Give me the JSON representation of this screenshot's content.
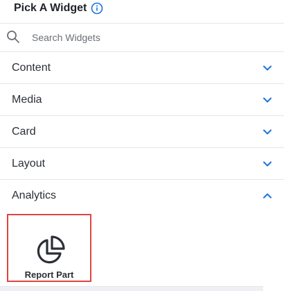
{
  "header": {
    "title": "Pick A Widget",
    "info_icon": "info-icon"
  },
  "search": {
    "placeholder": "Search Widgets",
    "value": "",
    "icon": "search-icon"
  },
  "sections": [
    {
      "label": "Content",
      "state": "collapsed",
      "icon": "chevron-down-icon"
    },
    {
      "label": "Media",
      "state": "collapsed",
      "icon": "chevron-down-icon"
    },
    {
      "label": "Card",
      "state": "collapsed",
      "icon": "chevron-down-icon"
    },
    {
      "label": "Layout",
      "state": "collapsed",
      "icon": "chevron-down-icon"
    },
    {
      "label": "Analytics",
      "state": "expanded",
      "icon": "chevron-up-icon"
    }
  ],
  "analytics_widgets": [
    {
      "label": "Report Part",
      "icon": "pie-chart-icon",
      "selected": true
    }
  ],
  "colors": {
    "accent": "#1a73d9",
    "selection_border": "#e0443e",
    "divider": "#e4e6ea",
    "text": "#2b2f36"
  }
}
